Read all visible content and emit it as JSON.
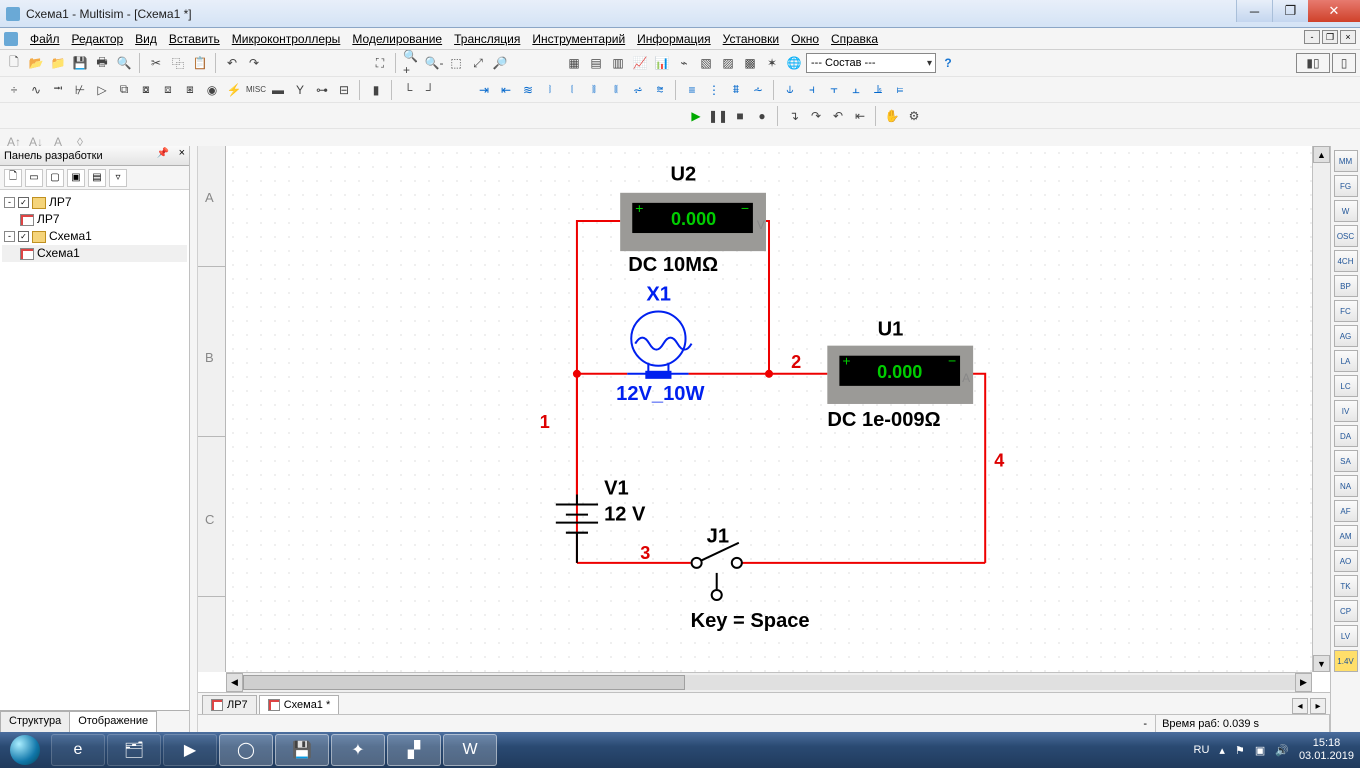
{
  "window": {
    "title": "Схема1 - Multisim - [Схема1 *]"
  },
  "menu": [
    "Файл",
    "Редактор",
    "Вид",
    "Вставить",
    "Микроконтроллеры",
    "Моделирование",
    "Трансляция",
    "Инструментарий",
    "Информация",
    "Установки",
    "Окно",
    "Справка"
  ],
  "toolbar_combo": "--- Состав ---",
  "left_panel": {
    "title": "Панель разработки",
    "tree": {
      "root1": "ЛР7",
      "child1": "ЛР7",
      "root2": "Схема1",
      "child2": "Схема1"
    },
    "tabs": {
      "a": "Структура",
      "b": "Отображение"
    }
  },
  "ruler": {
    "a": "A",
    "b": "B",
    "c": "C"
  },
  "doc_tabs": {
    "t1": "ЛР7",
    "t2": "Схема1 *"
  },
  "status": {
    "dash": "-",
    "runtime_label": "Время раб:",
    "runtime_val": "0.039 s"
  },
  "taskbar": {
    "lang": "RU",
    "time": "15:18",
    "date": "03.01.2019"
  },
  "schematic": {
    "nets": {
      "n1": "1",
      "n2": "2",
      "n3": "3",
      "n4": "4"
    },
    "U2": {
      "ref": "U2",
      "value": "0.000",
      "mode": "DC  10MΩ"
    },
    "U1": {
      "ref": "U1",
      "value": "0.000",
      "mode": "DC  1e-009Ω"
    },
    "X1": {
      "ref": "X1",
      "value": "12V_10W"
    },
    "V1": {
      "ref": "V1",
      "value": "12 V"
    },
    "J1": {
      "ref": "J1",
      "hint": "Key = Space"
    }
  }
}
